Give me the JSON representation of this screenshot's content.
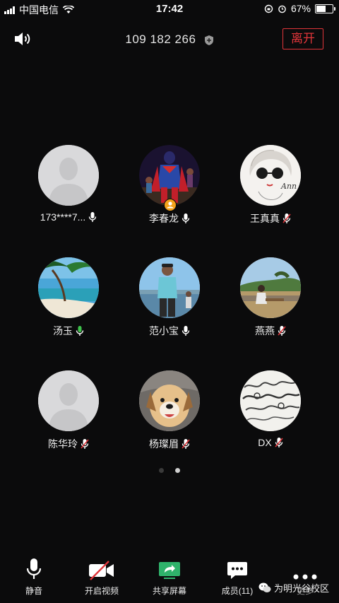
{
  "status_bar": {
    "carrier": "中国电信",
    "time": "17:42",
    "battery": "67%",
    "battery_level": 0.67
  },
  "header": {
    "meeting_id": "109 182 266",
    "leave_label": "离开"
  },
  "participants": [
    {
      "name": "173****7...",
      "mic": "on",
      "avatar": "default"
    },
    {
      "name": "李春龙",
      "mic": "on",
      "avatar": "photo",
      "host": true
    },
    {
      "name": "王真真",
      "mic": "muted",
      "avatar": "photo"
    },
    {
      "name": "汤玉",
      "mic": "speaking",
      "avatar": "photo"
    },
    {
      "name": "范小宝",
      "mic": "on",
      "avatar": "photo"
    },
    {
      "name": "燕燕",
      "mic": "muted",
      "avatar": "photo"
    },
    {
      "name": "陈华玲",
      "mic": "muted",
      "avatar": "default"
    },
    {
      "name": "杨璨眉",
      "mic": "muted",
      "avatar": "photo"
    },
    {
      "name": "DX",
      "mic": "muted",
      "avatar": "photo"
    }
  ],
  "pagination": {
    "total": 2,
    "current": 2
  },
  "toolbar": {
    "mute_label": "静音",
    "video_label": "开启视频",
    "share_label": "共享屏幕",
    "members_label": "成员(11)",
    "more_label": "更多"
  },
  "watermark": "为明光谷校区",
  "colors": {
    "background": "#0b0b0c",
    "leave": "#e0353a",
    "speaking_mic": "#3ec24b",
    "share_icon": "#2fb36b",
    "muted_slash": "#e0353a",
    "host_badge": "#f4a21a"
  }
}
